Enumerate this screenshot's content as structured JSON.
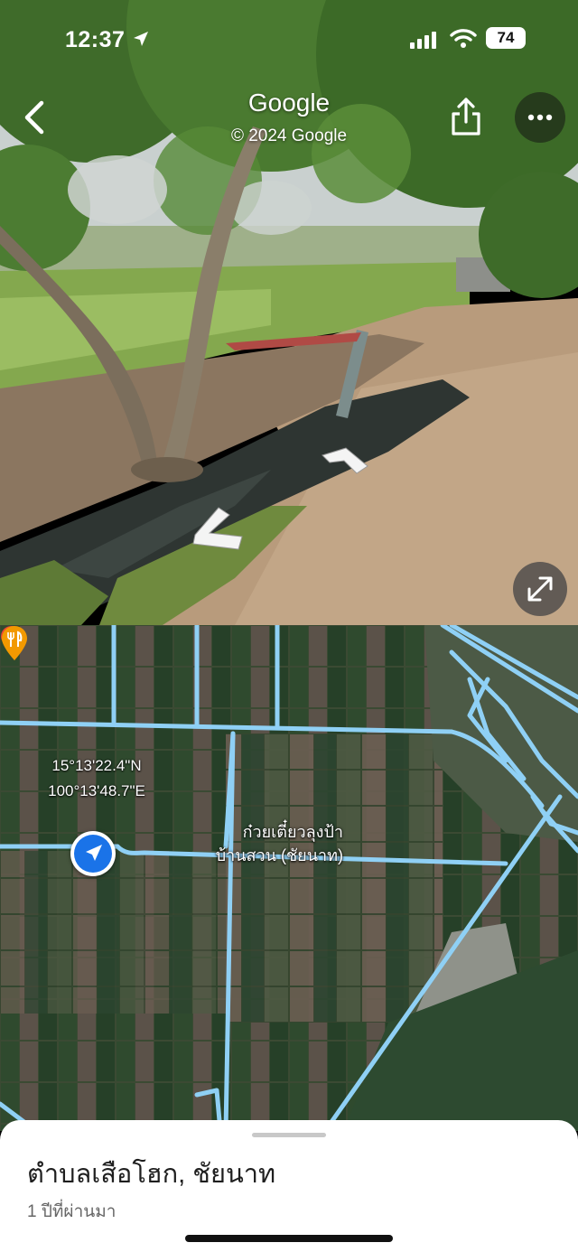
{
  "status_bar": {
    "time": "12:37",
    "battery": "74"
  },
  "street_view": {
    "brand": "Google",
    "copyright": "© 2024 Google",
    "icons": [
      "back-chevron-icon",
      "share-icon",
      "more-icon",
      "nav-arrow-icon",
      "expand-icon"
    ]
  },
  "map": {
    "coords_lat": "15°13'22.4\"N",
    "coords_lng": "100°13'48.7\"E",
    "poi_line1": "ก๋วยเตี๋ยวลุงป้า",
    "poi_line2": "บ้านสวน (ชัยนาท)",
    "poi_icon": "restaurant-icon",
    "road_color": "#8fd0f5",
    "location_color": "#1a73e8"
  },
  "sheet": {
    "title": "ตำบลเสือโฮก, ชัยนาท",
    "subtitle": "1 ปีที่ผ่านมา"
  }
}
